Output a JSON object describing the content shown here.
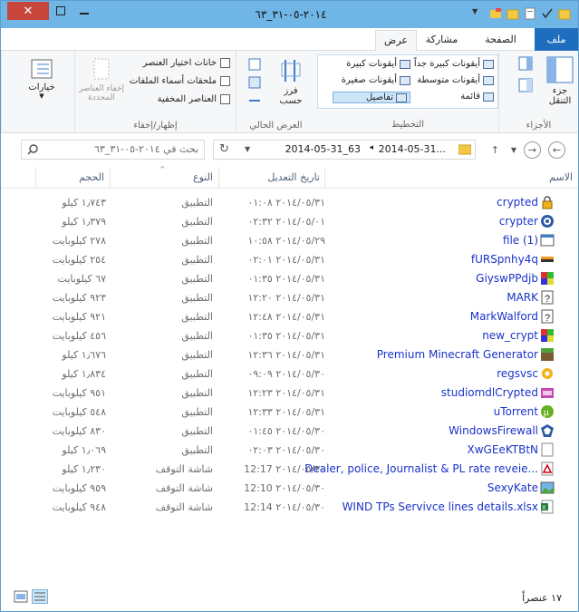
{
  "window": {
    "title": "٢٠١٤-٠٥-٣١_٦٣",
    "close_icon": "close-icon",
    "maximize_icon": "maximize-icon",
    "minimize_icon": "minimize-icon"
  },
  "tabs": [
    {
      "label": "ملف"
    },
    {
      "label": "الصفحة الرئيسية"
    },
    {
      "label": "مشاركة"
    },
    {
      "label": "عرض"
    }
  ],
  "ribbon": {
    "panes": {
      "label": "الأجزاء",
      "nav_pane": "جزء التنقل"
    },
    "layout": {
      "label": "التخطيط",
      "extra_large": "أيقونات كبيرة جداً",
      "large": "أيقونات كبيرة",
      "medium": "أيقونات متوسطة",
      "small": "أيقونات صغيرة",
      "list": "قائمة",
      "details": "تفاصيل"
    },
    "current_view": {
      "label": "العرض الحالي",
      "sort_by": "فرز حسب"
    },
    "show_hide": {
      "label": "إظهار/إخفاء",
      "item_checkboxes": "خانات اختيار العنصر",
      "file_extensions": "ملحقات أسماء الملفات",
      "hidden_items": "العناصر المخفية",
      "hide_selected": "إخفاء العناصر المحددة"
    },
    "options": "خيارات"
  },
  "address": {
    "path_folder": "2014-05-31...",
    "path_current": "2014-05-31_63",
    "search_placeholder": "بحث في ٢٠١٤-٠٥-٣١_٦٣"
  },
  "columns": {
    "name": "الاسم",
    "date": "تاريخ التعديل",
    "type": "النوع",
    "size": "الحجم"
  },
  "files": [
    {
      "name": "crypted",
      "date": "٢٠١٤/٠٥/٣١ ٠١:٠٨",
      "type": "التطبيق",
      "size": "١٫٧٤٣ كيلو",
      "icon": "lock-icon"
    },
    {
      "name": "crypter",
      "date": "٢٠١٤/٠٥/٠١ ٠٢:٣٢",
      "type": "التطبيق",
      "size": "١٫٣٧٩ كيلو",
      "icon": "globe-icon"
    },
    {
      "name": "file (1)",
      "date": "٢٠١٤/٠٥/٢٩ ١٠:٥٨",
      "type": "التطبيق",
      "size": "٢٧٨ كيلوبايت",
      "icon": "app-window-icon"
    },
    {
      "name": "fURSpnhy4q",
      "date": "٢٠١٤/٠٥/٣١ ٠٢:٠١",
      "type": "التطبيق",
      "size": "٢٥٤ كيلوبايت",
      "icon": "app-bar-icon"
    },
    {
      "name": "GiyswPPdjb",
      "date": "٢٠١٤/٠٥/٣١ ٠١:٣٥",
      "type": "التطبيق",
      "size": "٦٧ كيلوبايت",
      "icon": "mosaic-icon"
    },
    {
      "name": "MARK",
      "date": "٢٠١٤/٠٥/٣١ ١٢:٢٠",
      "type": "التطبيق",
      "size": "٩٢٣ كيلوبايت",
      "icon": "question-icon"
    },
    {
      "name": "MarkWalford",
      "date": "٢٠١٤/٠٥/٣١ ١٢:٤٨",
      "type": "التطبيق",
      "size": "٩٢١ كيلوبايت",
      "icon": "question-icon"
    },
    {
      "name": "new_crypt",
      "date": "٢٠١٤/٠٥/٣١ ٠١:٣٥",
      "type": "التطبيق",
      "size": "٤٥٦ كيلوبايت",
      "icon": "mosaic-icon"
    },
    {
      "name": "Premium Minecraft Generator",
      "date": "٢٠١٤/٠٥/٣١ ١٢:٣٦",
      "type": "التطبيق",
      "size": "١٫٦٧٦ كيلو",
      "icon": "minecraft-block-icon"
    },
    {
      "name": "regsvsc",
      "date": "٢٠١٤/٠٥/٣٠ ٠٩:٠٩",
      "type": "التطبيق",
      "size": "١٫٨٣٤ كيلو",
      "icon": "gear-icon"
    },
    {
      "name": "studiomdlCrypted",
      "date": "٢٠١٤/٠٥/٣١ ١٢:٢٣",
      "type": "التطبيق",
      "size": "٩٥١ كيلوبايت",
      "icon": "purple-app-icon"
    },
    {
      "name": "uTorrent",
      "date": "٢٠١٤/٠٥/٣١ ١٢:٣٣",
      "type": "التطبيق",
      "size": "٥٤٨ كيلوبايت",
      "icon": "utorrent-icon"
    },
    {
      "name": "WindowsFirewall",
      "date": "٢٠١٤/٠٥/٣٠ ٠١:٤٥",
      "type": "التطبيق",
      "size": "٨٣٠ كيلوبايت",
      "icon": "firewall-icon"
    },
    {
      "name": "XwGEeKTBtN",
      "date": "٢٠١٤/٠٥/٣٠ ٠٢:٠٣",
      "type": "التطبيق",
      "size": "١٫٠٦٩ كيلو",
      "icon": "blank-app-icon"
    },
    {
      "name": "Dealer, police, Journalist & PL rate reveie...",
      "date": "٢٠١٤/٠٥/٣٠ 12:17",
      "type": "شاشة التوقف",
      "size": "١٫٢٣٠ كيلو",
      "icon": "pdf-icon"
    },
    {
      "name": "SexyKate",
      "date": "٢٠١٤/٠٥/٣٠ 12:10",
      "type": "شاشة التوقف",
      "size": "٩٥٩ كيلوبايت",
      "icon": "image-icon"
    },
    {
      "name": "WIND TPs Servivce lines details.xlsx",
      "date": "٢٠١٤/٠٥/٣٠ 12:14",
      "type": "شاشة التوقف",
      "size": "٩٤٨ كيلوبايت",
      "icon": "excel-icon"
    }
  ],
  "status": {
    "count": "١٧ عنصراً"
  }
}
